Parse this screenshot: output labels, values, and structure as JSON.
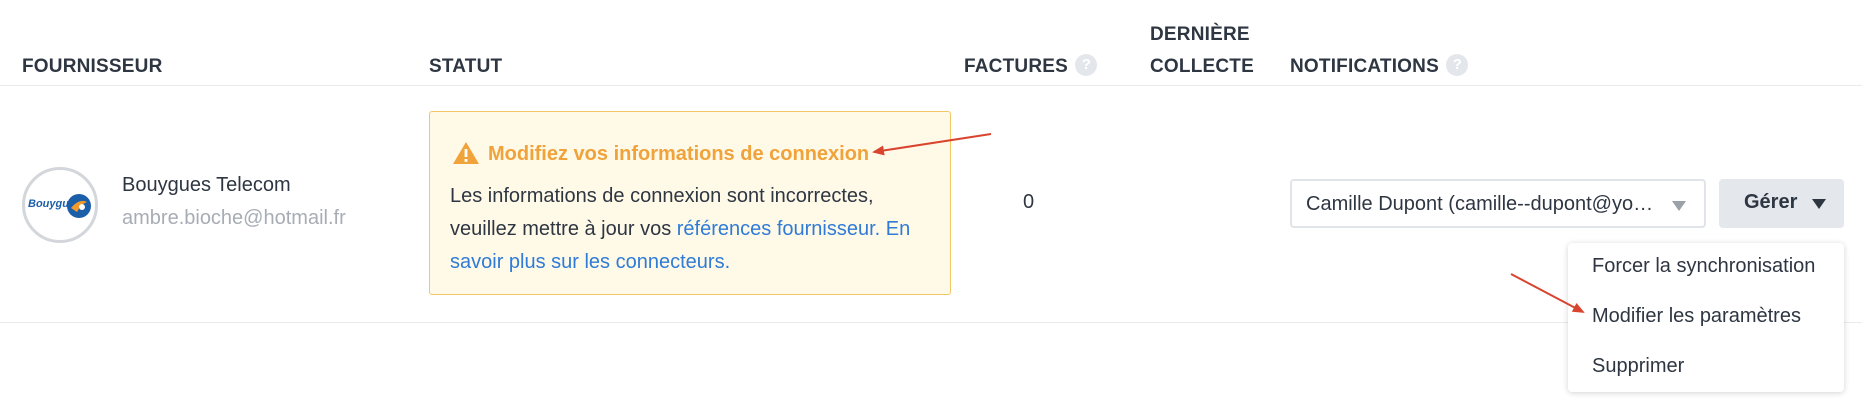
{
  "headers": {
    "provider": "FOURNISSEUR",
    "status": "STATUT",
    "invoices": "FACTURES",
    "last_collect_line1": "DERNIÈRE",
    "last_collect_line2": "COLLECTE",
    "notifications": "NOTIFICATIONS",
    "help_glyph": "?"
  },
  "row": {
    "logo_text": "Bouygues",
    "provider_name": "Bouygues Telecom",
    "provider_email": "ambre.bioche@hotmail.fr",
    "alert": {
      "title": "Modifiez vos informations de connexion",
      "body_text": "Les informations de connexion sont incorrectes, veuillez mettre à jour vos ",
      "link_references": "références fournisseur.",
      "link_learn_more": "En savoir plus sur les connecteurs."
    },
    "invoices_count": "0",
    "notification_recipient": "Camille Dupont (camille--dupont@yop…",
    "manage_label": "Gérer"
  },
  "menu": {
    "items": [
      "Forcer la synchronisation",
      "Modifier les paramètres",
      "Supprimer"
    ]
  },
  "colors": {
    "warning": "#f0a23b",
    "link": "#2f7bd6",
    "annotation_arrow": "#d9442f"
  },
  "icons": {
    "warning": "warning-triangle-icon",
    "help": "question-circle-icon",
    "caret": "caret-down-icon"
  }
}
